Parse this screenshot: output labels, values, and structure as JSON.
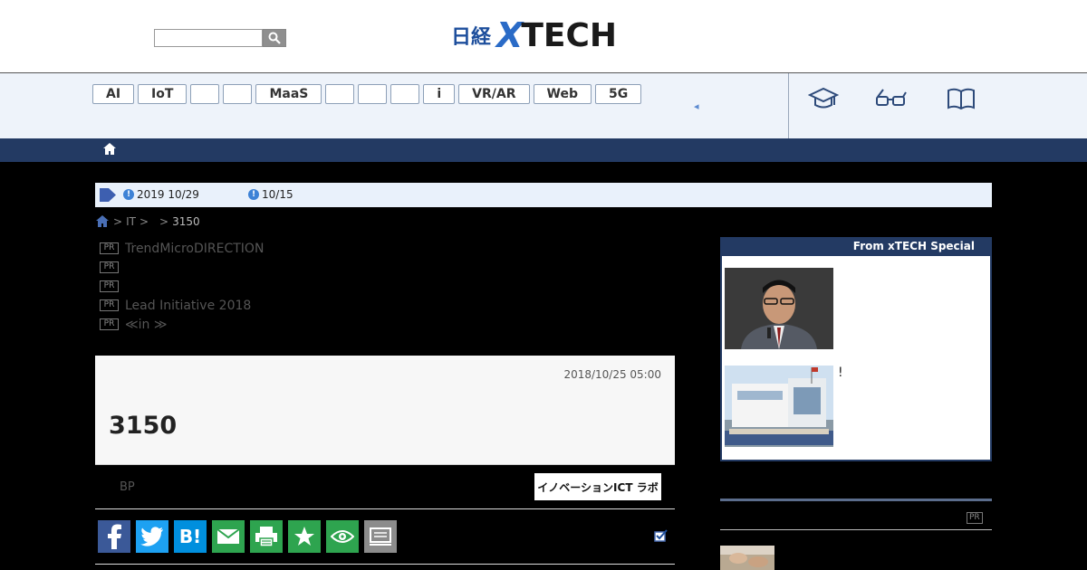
{
  "header": {
    "search_placeholder": "",
    "logo_nikkei": "日経",
    "logo_x": "X",
    "logo_tech": "TECH"
  },
  "nav": {
    "tags": [
      {
        "label": "AI"
      },
      {
        "label": "IoT"
      },
      {
        "label": ""
      },
      {
        "label": ""
      },
      {
        "label": "MaaS"
      },
      {
        "label": ""
      },
      {
        "label": ""
      },
      {
        "label": ""
      },
      {
        "label": "i"
      },
      {
        "label": "VR/AR"
      },
      {
        "label": "Web"
      },
      {
        "label": "5G"
      }
    ],
    "arrow": "◂",
    "icons": [
      "graduation-cap-icon",
      "glasses-icon",
      "book-icon"
    ]
  },
  "notice": {
    "item1": "2019 10/29",
    "item2": "10/15",
    "excl": "!"
  },
  "breadcrumb": {
    "sep1": ">",
    "it": "IT",
    "sep2": ">",
    "sep3": ">",
    "current": "3150"
  },
  "pr_badge": "PR",
  "pr_items": [
    "TrendMicroDIRECTION",
    "",
    "",
    "Lead Initiative 2018",
    "≪in ≫"
  ],
  "article": {
    "date": "2018/10/25 05:00",
    "title": "3150",
    "author": "BP",
    "labo_banner": "イノベーションICT ラボ"
  },
  "share": {
    "hatena": "B!"
  },
  "sidebar": {
    "special_heading": "From  xTECH Special",
    "item2_caption": "!",
    "pr": "PR"
  },
  "colors": {
    "navy": "#233a63",
    "brand_blue": "#2a6bc7",
    "facebook": "#3b5998",
    "twitter": "#1da1f2",
    "hatena": "#008fde",
    "mail": "#2ea44f",
    "print": "#2ea44f",
    "favorite": "#2ea44f",
    "watch": "#2ea44f",
    "memo": "#8c8c8c"
  }
}
